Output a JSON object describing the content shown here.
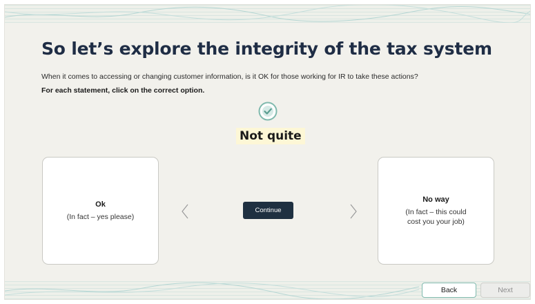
{
  "page": {
    "title": "So let’s explore the integrity of the tax system",
    "instruction": "When it comes to accessing or changing customer information, is it OK for those working for IR to take these actions?",
    "instruction_bold": "For each statement, click on the correct option.",
    "feedback": "Not quite",
    "feedback_icon": "check-circle-icon"
  },
  "cards": {
    "left": {
      "title": "Ok",
      "subtitle": "(In fact – yes please)"
    },
    "right": {
      "title": "No way",
      "subtitle": "(In fact – this could\ncost you your job)"
    }
  },
  "buttons": {
    "continue_label": "Continue",
    "back_label": "Back",
    "next_label": "Next"
  },
  "icons": {
    "prev": "chevron-left-icon",
    "next": "chevron-right-icon"
  },
  "colors": {
    "background": "#f2f1ec",
    "title": "#1f2d45",
    "continue_button": "#1f3041",
    "accent_teal": "#7fb9ad",
    "feedback_highlight": "#fdf7d6"
  }
}
